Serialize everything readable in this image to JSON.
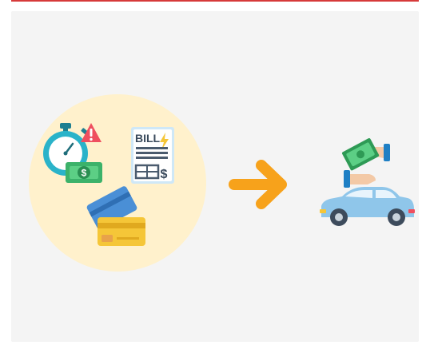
{
  "colors": {
    "top_rule": "#d63a3a",
    "panel_bg": "#f4f4f4",
    "circle_bg": "#fff1cc",
    "arrow": "#f7a21b",
    "car_body": "#8fc6ea",
    "cash_green": "#3cb26a",
    "card_blue": "#4a8fd6",
    "card_yellow": "#f5c638",
    "warning_red": "#ef4f5f",
    "stopwatch_teal": "#2ab3c9"
  },
  "icons": {
    "stopwatch": "stopwatch-icon",
    "warning": "warning-icon",
    "cash": "cash-icon",
    "bill": "bill-icon",
    "cards": "credit-cards-icon",
    "arrow": "arrow-right-icon",
    "payment_hands": "hand-paying-cash-icon",
    "car": "car-icon"
  },
  "bill": {
    "title": "BILL",
    "currency_symbol": "$"
  },
  "cash": {
    "currency_symbol": "$"
  }
}
